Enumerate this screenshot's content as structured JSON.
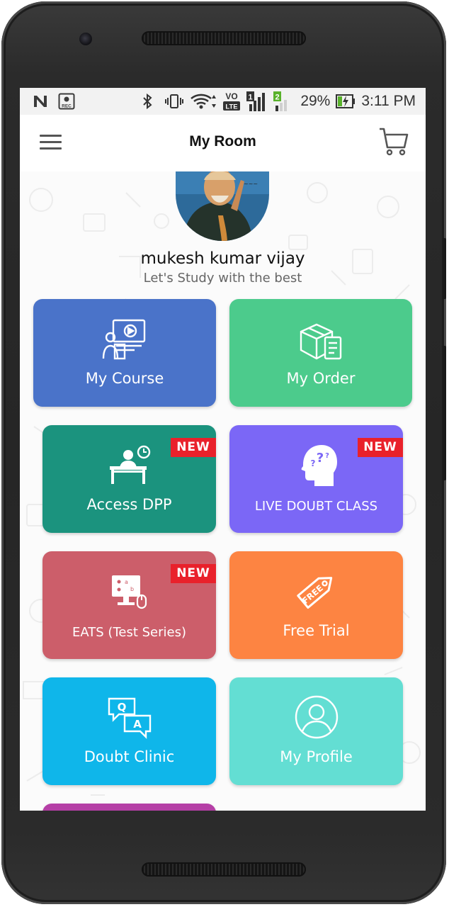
{
  "status_bar": {
    "battery_percent": "29%",
    "time": "3:11 PM",
    "volte_label": "VO",
    "lte_label": "LTE",
    "sim1_label": "1",
    "sim2_label": "2",
    "rec_label": "REC",
    "icons": [
      "n-notification-icon",
      "recording-icon",
      "bluetooth-icon",
      "vibrate-icon",
      "wifi-icon",
      "volte-icon",
      "signal-sim1-icon",
      "signal-sim2-icon",
      "battery-charging-icon"
    ]
  },
  "app_bar": {
    "title": "My Room",
    "menu_icon": "hamburger-menu-icon",
    "cart_icon": "shopping-cart-icon"
  },
  "profile": {
    "name": "mukesh kumar vijay",
    "tagline": "Let's Study with the best"
  },
  "tiles": [
    {
      "label": "My Course",
      "color": "#4a73c9",
      "icon": "video-course-icon",
      "badge": ""
    },
    {
      "label": "My Order",
      "color": "#4ccb8c",
      "icon": "package-order-icon",
      "badge": ""
    },
    {
      "label": "Access DPP",
      "color": "#1b937e",
      "icon": "desk-student-icon",
      "badge": "NEW"
    },
    {
      "label": "LIVE DOUBT CLASS",
      "color": "#7b67f6",
      "icon": "head-question-icon",
      "badge": "NEW"
    },
    {
      "label": "EATS (Test Series)",
      "color": "#cc5e6a",
      "icon": "computer-test-icon",
      "badge": "NEW"
    },
    {
      "label": "Free Trial",
      "color": "#fd8442",
      "icon": "free-tag-icon",
      "badge": ""
    },
    {
      "label": "Doubt Clinic",
      "color": "#0fb6ea",
      "icon": "qa-chat-icon",
      "badge": ""
    },
    {
      "label": "My Profile",
      "color": "#63ded3",
      "icon": "user-profile-icon",
      "badge": ""
    },
    {
      "label": "",
      "color": "#b53fa6",
      "icon": "",
      "badge": ""
    }
  ],
  "free_tag_text": "FREE",
  "qa_q": "Q",
  "qa_a": "A"
}
